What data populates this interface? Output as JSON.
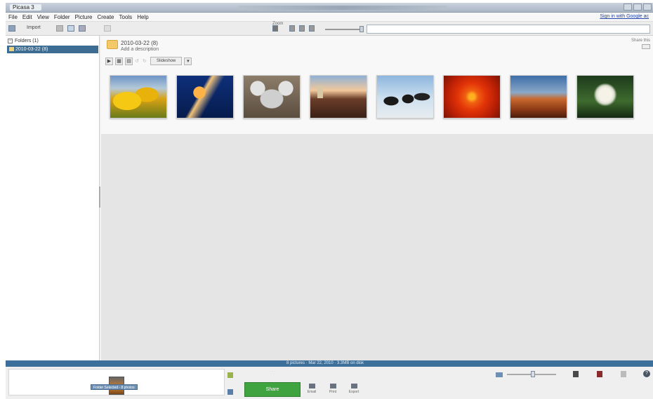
{
  "window": {
    "title": "Picasa 3"
  },
  "menu": {
    "items": [
      "File",
      "Edit",
      "View",
      "Folder",
      "Picture",
      "Create",
      "Tools",
      "Help"
    ],
    "signin": "Sign in with Google ac"
  },
  "toolbar": {
    "import": "Import",
    "zoom_label": "Zoom",
    "search_value": ""
  },
  "sidebar": {
    "root": "Folders (1)",
    "selected": "2010-03-22 (8)"
  },
  "album": {
    "title": "2010-03-22 (8)",
    "subtitle": "Add a description",
    "right_text": "Share this",
    "slideshow": "Slideshow",
    "thumbnails": [
      {
        "name": "Tulips"
      },
      {
        "name": "Jellyfish"
      },
      {
        "name": "Koala"
      },
      {
        "name": "Lighthouse"
      },
      {
        "name": "Penguins"
      },
      {
        "name": "Chrysanthemum"
      },
      {
        "name": "Desert"
      },
      {
        "name": "Hydrangeas"
      }
    ]
  },
  "status": {
    "text": "8 pictures · Mar 22, 2010 · 3.3MB on disk"
  },
  "tray": {
    "label": "Folder Selected - 8 photos",
    "share": "Share",
    "actions": [
      "Email",
      "Print",
      "Export"
    ],
    "colors": {
      "accent": "#3c6f9a",
      "share": "#3fa33f"
    }
  }
}
